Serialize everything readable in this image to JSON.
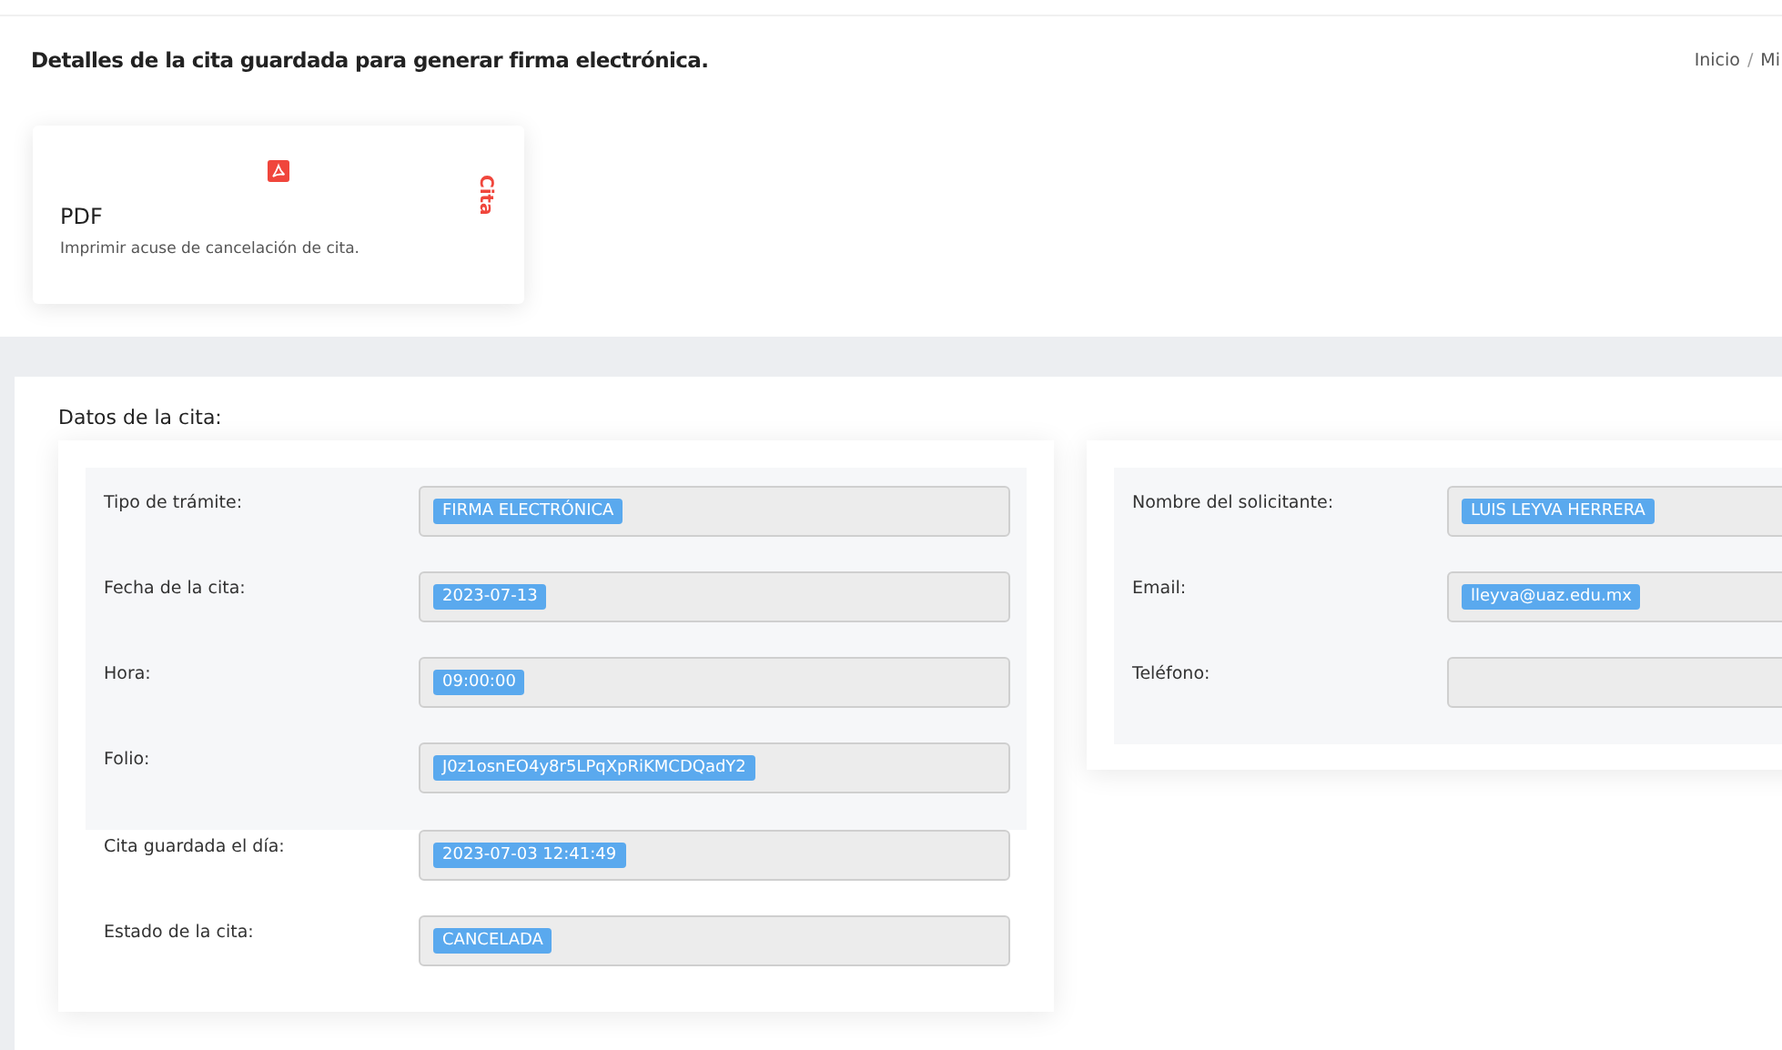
{
  "header": {
    "title": "Detalles de la cita guardada para generar firma electrónica.",
    "breadcrumb": {
      "items": [
        "Inicio",
        "Mi"
      ],
      "separator": "/"
    }
  },
  "pdf_card": {
    "title": "PDF",
    "description": "Imprimir acuse de cancelación de cita.",
    "side_label": "Cita"
  },
  "details": {
    "title": "Datos de la cita:",
    "panels": [
      {
        "fields": [
          {
            "label": "Tipo de trámite:",
            "value": "FIRMA ELECTRÓNICA",
            "highlighted": true
          },
          {
            "label": "Fecha de la cita:",
            "value": "2023-07-13",
            "highlighted": true
          },
          {
            "label": "Hora:",
            "value": "09:00:00",
            "highlighted": true
          },
          {
            "label": "Folio:",
            "value": "J0z1osnEO4y8r5LPqXpRiKMCDQadY2",
            "highlighted": true
          },
          {
            "label": "Cita guardada el día:",
            "value": "2023-07-03 12:41:49",
            "highlighted": false
          },
          {
            "label": "Estado de la cita:",
            "value": "CANCELADA",
            "highlighted": false
          }
        ]
      },
      {
        "fields": [
          {
            "label": "Nombre del solicitante:",
            "value": "LUIS LEYVA HERRERA",
            "highlighted": true
          },
          {
            "label": "Email:",
            "value": "lleyva@uaz.edu.mx",
            "highlighted": true
          },
          {
            "label": "Teléfono:",
            "highlighted": true
          }
        ]
      }
    ]
  }
}
